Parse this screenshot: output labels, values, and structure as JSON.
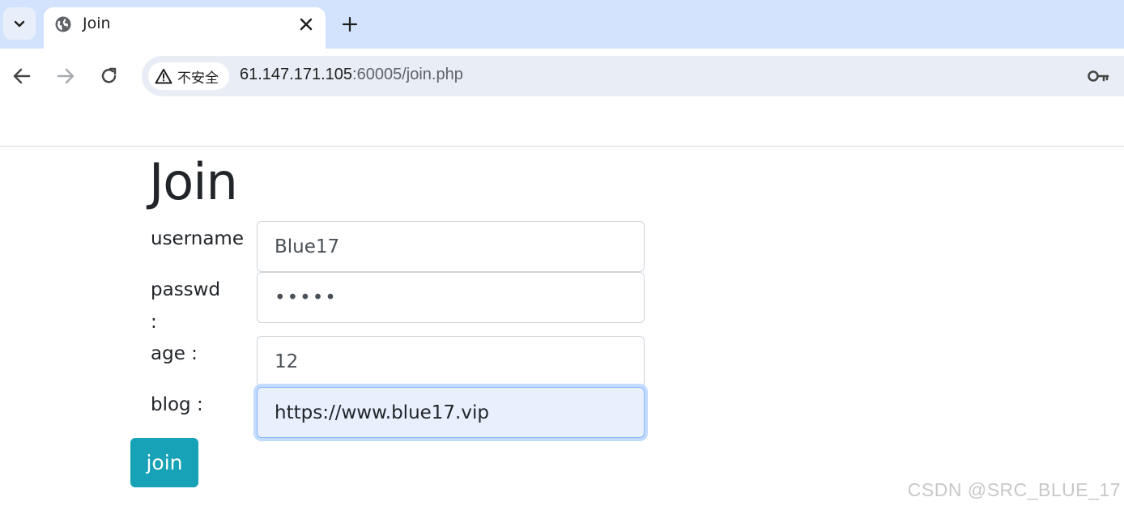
{
  "browser": {
    "tab_title": "Join",
    "security_label": "不安全",
    "url_host": "61.147.171.105",
    "url_rest": ":60005/join.php"
  },
  "page": {
    "heading": "Join",
    "fields": [
      {
        "label": "username",
        "value": "Blue17"
      },
      {
        "label": "passwd\n:",
        "value": "•••••"
      },
      {
        "label": "age :",
        "value": "12"
      },
      {
        "label": "blog :",
        "value": "https://www.blue17.vip"
      }
    ],
    "submit_label": "join"
  },
  "watermark": "CSDN @SRC_BLUE_17",
  "colors": {
    "tabstrip": "#d3e3fd",
    "omnibox": "#e9eef6",
    "button": "#17a2b8",
    "focus_ring": "#c2dbfe"
  }
}
